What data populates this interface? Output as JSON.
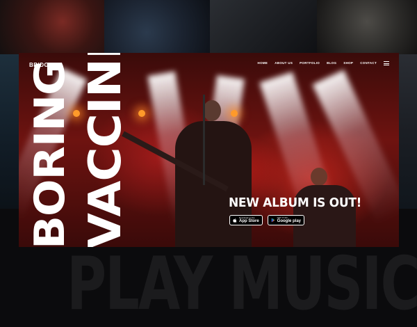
{
  "background": {
    "big_text": "PLAY MUSIC"
  },
  "header": {
    "brand": "BRIDGE",
    "nav": [
      "HOME",
      "ABOUT US",
      "PORTFOLIO",
      "BLOG",
      "SHOP",
      "CONTACT"
    ]
  },
  "hero": {
    "title_line1": "BORING",
    "title_line2": "VACCINES",
    "headline": "NEW ALBUM IS OUT!",
    "app_store": {
      "small": "Download on the",
      "big": "App Store"
    },
    "google_play": {
      "small": "GET IT ON",
      "big": "Google play"
    }
  },
  "colors": {
    "accent_red": "#c01a14",
    "spotlight_orange": "#ff9a2a",
    "text": "#ffffff"
  }
}
